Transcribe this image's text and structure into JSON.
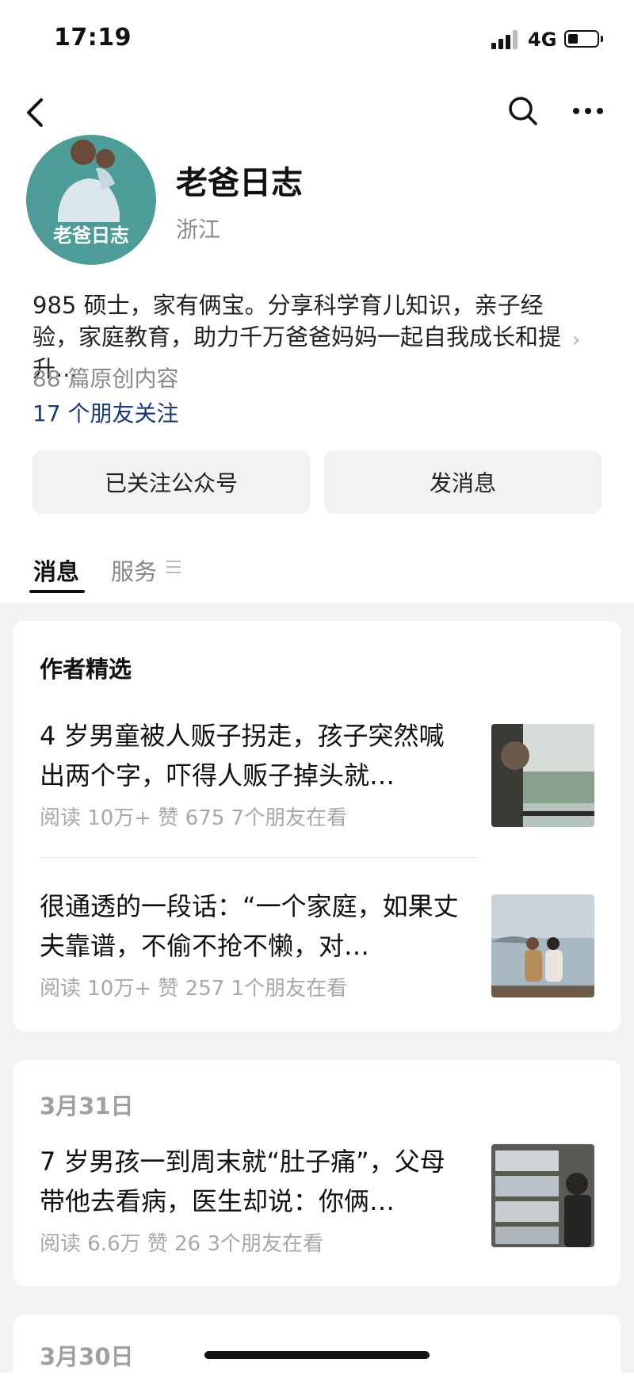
{
  "status_bar": {
    "time": "17:19",
    "network": "4G",
    "battery_level": 0.35
  },
  "profile": {
    "avatar_text": "老爸日志",
    "name": "老爸日志",
    "region": "浙江",
    "bio": "985 硕士，家有俩宝。分享科学育儿知识，亲子经验，家庭教育，助力千万爸爸妈妈一起自我成长和提升...",
    "original_count": "88 篇原创内容",
    "friends_following": "17 个朋友关注"
  },
  "actions": {
    "follow_label": "已关注公众号",
    "message_label": "发消息"
  },
  "tabs": [
    {
      "label": "消息"
    },
    {
      "label": "服务"
    }
  ],
  "featured": {
    "title": "作者精选",
    "articles": [
      {
        "title": "4 岁男童被人贩子拐走，孩子突然喊出两个字，吓得人贩子掉头就…",
        "meta": "阅读 10万+  赞 675  7个朋友在看"
      },
      {
        "title": "很通透的一段话：“一个家庭，如果丈夫靠谱，不偷不抢不懒，对…",
        "meta": "阅读 10万+  赞 257  1个朋友在看"
      }
    ]
  },
  "feed": [
    {
      "date": "3月31日",
      "title": "7 岁男孩一到周末就“肚子痛”，父母带他去看病，医生却说：你俩…",
      "meta": "阅读 6.6万  赞 26  3个朋友在看"
    },
    {
      "date": "3月30日"
    }
  ]
}
